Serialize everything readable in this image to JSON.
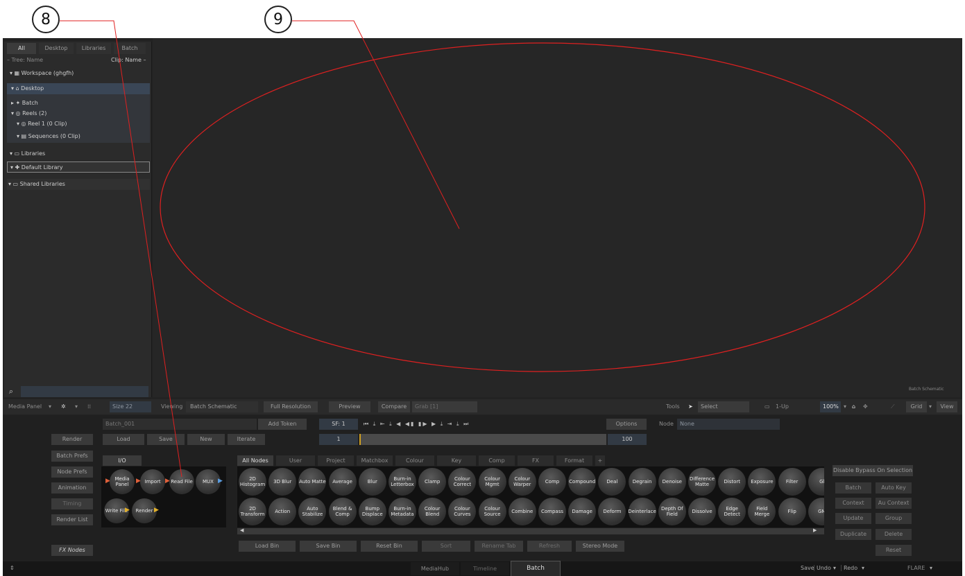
{
  "callouts": {
    "a": "8",
    "b": "9"
  },
  "library_tabs": [
    "All",
    "Desktop",
    "Libraries",
    "Batch"
  ],
  "tree_header": {
    "left": "– Tree: Name",
    "right": "Clip: Name –"
  },
  "tree": {
    "workspace": "▾ ▦ Workspace (ghgfh)",
    "desktop": "▾ ⌂ Desktop",
    "batch": "▸ ✦ Batch",
    "reels": "▾ ◎ Reels (2)",
    "reel1": "▾ ◎ Reel 1 (0 Clip)",
    "sequences": "▾ ▤ Sequences (0 Clip)",
    "libraries": "▾ ▭ Libraries",
    "default_library": "▾ ✚ Default Library",
    "shared_libraries": "▾ ▭ Shared Libraries"
  },
  "viewer": {
    "corner_label": "Batch Schematic"
  },
  "toolbar": {
    "media_panel": "Media Panel",
    "size": "Size 22",
    "viewing_label": "Viewing",
    "viewing_value": "Batch Schematic",
    "resolution": "Full Resolution",
    "preview": "Preview",
    "compare": "Compare",
    "grab": "Grab [1]",
    "tools_label": "Tools",
    "select": "Select",
    "layout": "1-Up",
    "zoom": "100%",
    "grid": "Grid",
    "view": "View"
  },
  "batch": {
    "name": "Batch_001",
    "add_token": "Add Token",
    "load": "Load",
    "save": "Save",
    "new": "New",
    "iterate": "Iterate",
    "sf": "SF: 1",
    "start_frame": "1",
    "end_frame": "100",
    "options": "Options",
    "node_label": "Node",
    "node_value": "None"
  },
  "left_buttons": [
    "Render",
    "Batch Prefs",
    "Node Prefs",
    "Animation",
    "Timing",
    "Render List"
  ],
  "fx_nodes": "FX Nodes",
  "io_tab": "I/O",
  "io_nodes": {
    "media_panel": "Media Panel",
    "import": "Import",
    "read_file": "Read File",
    "mux": "MUX",
    "write_file": "Write File",
    "render": "Render"
  },
  "node_tabs": [
    "All Nodes",
    "User",
    "Project",
    "Matchbox",
    "Colour",
    "Key",
    "Comp",
    "FX",
    "Format",
    "+"
  ],
  "nodes_row1": [
    "2D Histogram",
    "3D Blur",
    "Auto Matte",
    "Average",
    "Blur",
    "Burn-in Letterbox",
    "Clamp",
    "Colour Correct",
    "Colour Mgmt",
    "Colour Warper",
    "Comp",
    "Compound",
    "Deal",
    "Degrain",
    "Denoise",
    "Difference Matte",
    "Distort",
    "Exposure",
    "Filter",
    "Gl"
  ],
  "nodes_row2": [
    "2D Transform",
    "Action",
    "Auto Stabilize",
    "Blend & Comp",
    "Bump Displace",
    "Burn-in Metadata",
    "Colour Blend",
    "Colour Curves",
    "Colour Source",
    "Combine",
    "Compass",
    "Damage",
    "Deform",
    "Deinterlace",
    "Depth Of Field",
    "Dissolve",
    "Edge Detect",
    "Field Merge",
    "Flip",
    "GM"
  ],
  "bin_buttons": [
    "Load Bin",
    "Save Bin",
    "Reset Bin",
    "Sort",
    "Rename Tab",
    "Refresh",
    "Stereo Mode"
  ],
  "right_buttons": {
    "disable_bypass": "Disable Bypass On Selection",
    "batch": "Batch",
    "auto_key": "Auto Key",
    "context": "Context",
    "au_context": "Au Context",
    "update": "Update",
    "group": "Group",
    "duplicate": "Duplicate",
    "delete": "Delete",
    "reset": "Reset"
  },
  "bottom_tabs": [
    "MediaHub",
    "Timeline",
    "Batch"
  ],
  "status": {
    "save": "Save",
    "undo": "Undo",
    "redo": "Redo",
    "app": "FLARE"
  }
}
